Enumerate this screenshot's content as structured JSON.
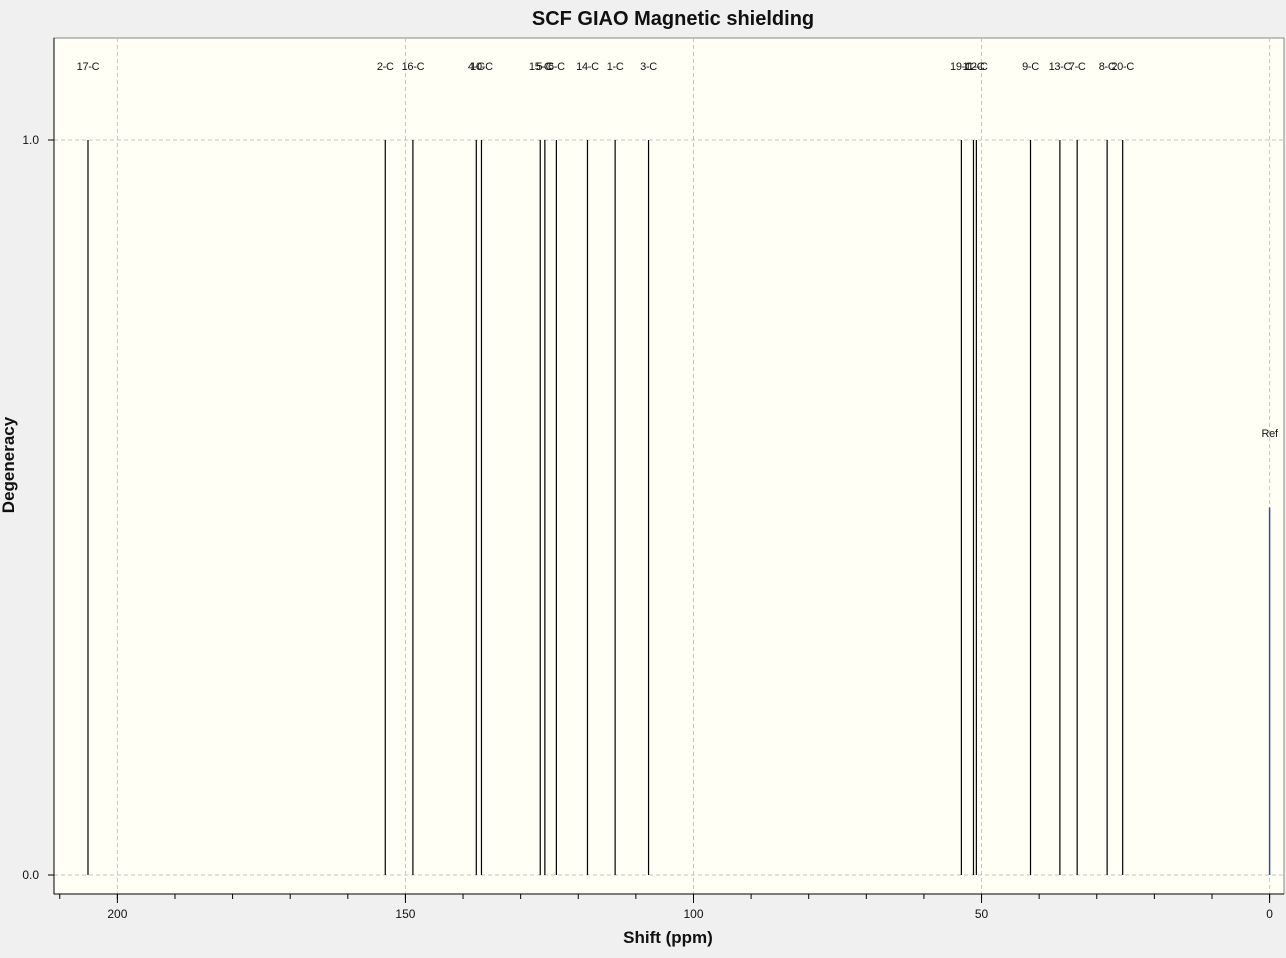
{
  "chart_data": {
    "type": "bar",
    "title": "SCF GIAO Magnetic shielding",
    "xlabel": "Shift (ppm)",
    "ylabel": "Degeneracy",
    "x_reversed": true,
    "xlim": [
      211,
      -2.5
    ],
    "ylim": [
      0,
      1.1
    ],
    "x_ticks": [
      200,
      150,
      100,
      50,
      0
    ],
    "x_minor_step": 10,
    "y_ticks": [
      "0.0",
      "1.0"
    ],
    "y_tick_values": [
      0,
      1
    ],
    "grid": true,
    "peak_color": "#000000",
    "reference_color": "#3b4aa8",
    "plot_background": "#fffff6",
    "figure_background": "#f0f0f0",
    "peaks": [
      {
        "label": "17-C",
        "x": 205.1,
        "y": 1
      },
      {
        "label": "2-C",
        "x": 153.5,
        "y": 1
      },
      {
        "label": "16-C",
        "x": 148.7,
        "y": 1
      },
      {
        "label": "4-C",
        "x": 137.7,
        "y": 1
      },
      {
        "label": "10-C",
        "x": 136.8,
        "y": 1
      },
      {
        "label": "15-C",
        "x": 126.6,
        "y": 1
      },
      {
        "label": "5-C",
        "x": 125.8,
        "y": 1
      },
      {
        "label": "6-C",
        "x": 123.8,
        "y": 1
      },
      {
        "label": "14-C",
        "x": 118.4,
        "y": 1
      },
      {
        "label": "1-C",
        "x": 113.6,
        "y": 1
      },
      {
        "label": "3-C",
        "x": 107.8,
        "y": 1
      },
      {
        "label": "19-C",
        "x": 53.5,
        "y": 1
      },
      {
        "label": "11-C",
        "x": 51.4,
        "y": 1
      },
      {
        "label": "12-C",
        "x": 50.9,
        "y": 1
      },
      {
        "label": "9-C",
        "x": 41.5,
        "y": 1
      },
      {
        "label": "13-C",
        "x": 36.4,
        "y": 1
      },
      {
        "label": "7-C",
        "x": 33.4,
        "y": 1
      },
      {
        "label": "8-C",
        "x": 28.2,
        "y": 1
      },
      {
        "label": "20-C",
        "x": 25.5,
        "y": 1
      }
    ],
    "reference": {
      "label": "Ref",
      "x": 0,
      "y": 0.5
    }
  }
}
